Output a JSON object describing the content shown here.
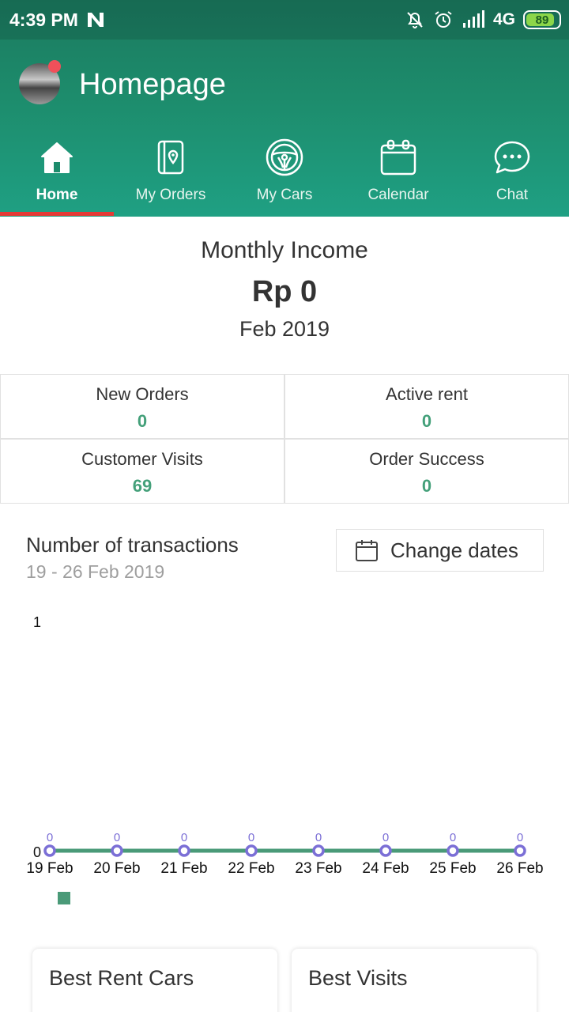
{
  "status_bar": {
    "time": "4:39 PM",
    "network": "4G",
    "battery": "89",
    "battery_level": 0.89
  },
  "header": {
    "title": "Homepage"
  },
  "tabs": [
    {
      "label": "Home",
      "icon": "home-icon",
      "active": true
    },
    {
      "label": "My Orders",
      "icon": "orders-map-icon",
      "active": false
    },
    {
      "label": "My Cars",
      "icon": "steering-wheel-icon",
      "active": false
    },
    {
      "label": "Calendar",
      "icon": "calendar-icon",
      "active": false
    },
    {
      "label": "Chat",
      "icon": "chat-icon",
      "active": false
    }
  ],
  "income": {
    "title": "Monthly Income",
    "value": "Rp 0",
    "month": "Feb 2019"
  },
  "stats": [
    {
      "label": "New Orders",
      "value": "0"
    },
    {
      "label": "Active rent",
      "value": "0"
    },
    {
      "label": "Customer Visits",
      "value": "69"
    },
    {
      "label": "Order Success",
      "value": "0"
    }
  ],
  "transactions": {
    "title": "Number of transactions",
    "range": "19 - 26 Feb 2019",
    "change_label": "Change dates"
  },
  "chart_data": {
    "type": "line",
    "title": "",
    "xlabel": "",
    "ylabel": "",
    "categories": [
      "19 Feb",
      "20 Feb",
      "21 Feb",
      "22 Feb",
      "23 Feb",
      "24 Feb",
      "25 Feb",
      "26 Feb"
    ],
    "series": [
      {
        "values": [
          0,
          0,
          0,
          0,
          0,
          0,
          0,
          0
        ],
        "color": "#4a9a78",
        "marker_color": "#7b6fd6"
      }
    ],
    "ylim": [
      0,
      1
    ],
    "yticks": [
      "1",
      "0"
    ],
    "grid": false,
    "legend": "bottom-left"
  },
  "cards": [
    {
      "title": "Best Rent Cars"
    },
    {
      "title": "Best Visits"
    }
  ],
  "colors": {
    "accent": "#44a07a",
    "header": "#1d8c6c",
    "indicator": "#e53935",
    "notification": "#f0505a"
  }
}
